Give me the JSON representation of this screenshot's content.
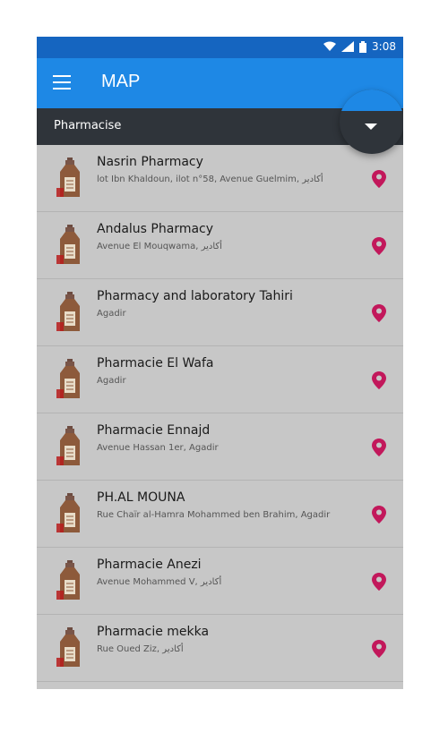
{
  "status": {
    "time": "3:08"
  },
  "appbar": {
    "title": "MAP"
  },
  "subbar": {
    "label": "Pharmacise"
  },
  "pharmacies": [
    {
      "name": "Nasrin Pharmacy",
      "address": "lot Ibn Khaldoun, ilot n°58, Avenue Guelmim, أكادير"
    },
    {
      "name": "Andalus Pharmacy",
      "address": "Avenue El Mouqwama, أكادير"
    },
    {
      "name": "Pharmacy and laboratory Tahiri",
      "address": "Agadir"
    },
    {
      "name": "Pharmacie El Wafa",
      "address": "Agadir"
    },
    {
      "name": "Pharmacie Ennajd",
      "address": "Avenue Hassan 1er, Agadir"
    },
    {
      "name": "PH.AL MOUNA",
      "address": "Rue Chaïr al-Hamra Mohammed ben Brahim, Agadir"
    },
    {
      "name": "Pharmacie Anezi",
      "address": "Avenue Mohammed V, أكادير"
    },
    {
      "name": "Pharmacie mekka",
      "address": "Rue Oued Ziz, أكادير"
    }
  ],
  "colors": {
    "statusbar": "#1565c0",
    "appbar": "#1e88e5",
    "subbar": "#2f343a",
    "pin": "#c2185b",
    "list_bg": "#c7c7c7"
  },
  "icons": {
    "row_icon": "medicine-bottle-icon",
    "row_action": "location-pin-icon",
    "fab": "chevron-down-icon"
  }
}
